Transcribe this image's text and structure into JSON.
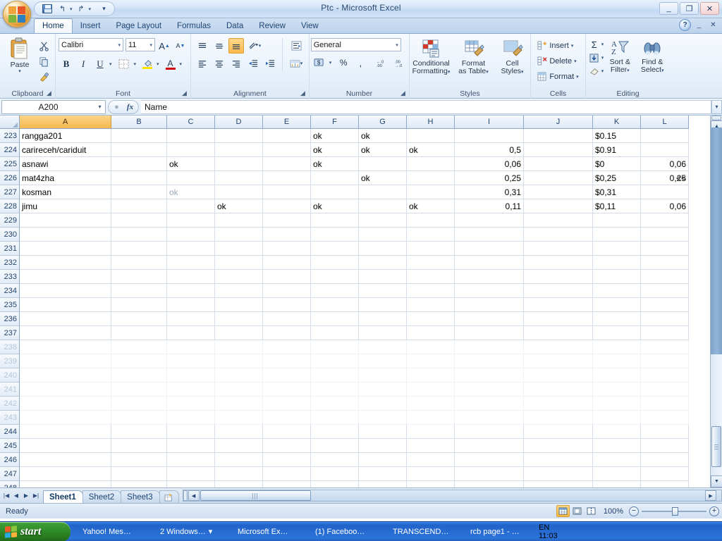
{
  "window": {
    "title": "Ptc - Microsoft Excel",
    "minimize": "_",
    "restore": "❐",
    "close": "✕"
  },
  "quick_access": {
    "save": "save-icon",
    "undo": "↰",
    "undo_arrow": "▾",
    "redo": "↱",
    "redo_arrow": "▾",
    "customize": "▾"
  },
  "ribbon": {
    "tabs": [
      {
        "label": "Home",
        "active": true
      },
      {
        "label": "Insert",
        "active": false
      },
      {
        "label": "Page Layout",
        "active": false
      },
      {
        "label": "Formulas",
        "active": false
      },
      {
        "label": "Data",
        "active": false
      },
      {
        "label": "Review",
        "active": false
      },
      {
        "label": "View",
        "active": false
      }
    ],
    "help": "?",
    "minimize_ribbon": "_",
    "close_window": "✕",
    "groups": {
      "clipboard": {
        "label": "Clipboard",
        "paste": "Paste",
        "paste_arrow": "▾",
        "cut": "✂",
        "copy": "⧉",
        "format_painter": "🖌",
        "dialog": "◢"
      },
      "font": {
        "label": "Font",
        "font_name": "Calibri",
        "font_size": "11",
        "grow_font": "A",
        "shrink_font": "A",
        "bold": "B",
        "italic": "I",
        "underline": "U",
        "borders": "▦",
        "fill_color": "A",
        "font_color": "A",
        "dropdown": "▾",
        "dialog": "◢"
      },
      "alignment": {
        "label": "Alignment",
        "align_top": "≡",
        "align_middle": "≡",
        "align_bottom": "≡",
        "orientation": "⤢",
        "align_left": "≡",
        "align_center": "≡",
        "align_right": "≡",
        "decrease_indent": "⇤",
        "increase_indent": "⇥",
        "wrap_text": "↵",
        "merge_center": "⊞",
        "dropdown": "▾",
        "dialog": "◢"
      },
      "number": {
        "label": "Number",
        "format": "General",
        "accounting": "$",
        "percent": "%",
        "comma": ",",
        "increase_decimal": "+.0",
        "decrease_decimal": "-.0",
        "dropdown": "▾",
        "dialog": "◢"
      },
      "styles": {
        "label": "Styles",
        "conditional_formatting": "Conditional\nFormatting",
        "conditional_formatting_l1": "Conditional",
        "conditional_formatting_l2": "Formatting",
        "format_as_table_l1": "Format",
        "format_as_table_l2": "as Table",
        "cell_styles_l1": "Cell",
        "cell_styles_l2": "Styles",
        "arrow": "▾"
      },
      "cells": {
        "label": "Cells",
        "insert": "Insert",
        "delete": "Delete",
        "format": "Format",
        "arrow": "▾"
      },
      "editing": {
        "label": "Editing",
        "autosum": "Σ",
        "fill": "⬇",
        "clear": "⌫",
        "sort_filter_l1": "Sort &",
        "sort_filter_l2": "Filter",
        "find_select_l1": "Find &",
        "find_select_l2": "Select",
        "arrow": "▾"
      }
    }
  },
  "formula_bar": {
    "name_box": "A200",
    "name_box_arrow": "▾",
    "cancel": "✕",
    "enter": "✓",
    "insert_function": "fx",
    "content": "Name",
    "expand_arrow": "▾"
  },
  "grid": {
    "select_all": "select-all-corner",
    "columns": [
      {
        "letter": "A",
        "width": 130,
        "selected": true
      },
      {
        "letter": "B",
        "width": 79,
        "selected": false
      },
      {
        "letter": "C",
        "width": 68,
        "selected": false
      },
      {
        "letter": "D",
        "width": 68,
        "selected": false
      },
      {
        "letter": "E",
        "width": 68,
        "selected": false
      },
      {
        "letter": "F",
        "width": 68,
        "selected": false
      },
      {
        "letter": "G",
        "width": 68,
        "selected": false
      },
      {
        "letter": "H",
        "width": 68,
        "selected": false
      },
      {
        "letter": "I",
        "width": 98,
        "selected": false
      },
      {
        "letter": "J",
        "width": 98,
        "selected": false
      },
      {
        "letter": "K",
        "width": 68,
        "selected": false
      },
      {
        "letter": "L",
        "width": 68,
        "selected": false
      }
    ],
    "rows": [
      {
        "num": "223",
        "faded": false,
        "cells": {
          "A": "rangga201",
          "F": "ok",
          "G": "ok",
          "K": "$0.15"
        }
      },
      {
        "num": "224",
        "faded": false,
        "cells": {
          "A": "carireceh/cariduit",
          "F": "ok",
          "G": "ok",
          "H": "ok",
          "I": "0,5",
          "K": "$0.91"
        }
      },
      {
        "num": "225",
        "faded": false,
        "cells": {
          "A": "asnawi",
          "C": "ok",
          "F": "ok",
          "I": "0,06",
          "K": "$0",
          "L": "0,06"
        }
      },
      {
        "num": "226",
        "faded": false,
        "cells": {
          "A": "mat4zha",
          "G": "ok",
          "I": "0,25",
          "K": "$0,25",
          "L": "0,25",
          "M": "<<"
        }
      },
      {
        "num": "227",
        "faded": false,
        "cells": {
          "A": "kosman",
          "C": "ok",
          "I": "0,31",
          "K": "$0,31"
        },
        "gray": [
          "C"
        ]
      },
      {
        "num": "228",
        "faded": false,
        "cells": {
          "A": "jimu",
          "D": "ok",
          "F": "ok",
          "H": "ok",
          "I": "0,11",
          "K": "$0,11",
          "L": "0,06"
        }
      },
      {
        "num": "229",
        "faded": false,
        "cells": {}
      },
      {
        "num": "230",
        "faded": false,
        "cells": {}
      },
      {
        "num": "231",
        "faded": false,
        "cells": {}
      },
      {
        "num": "232",
        "faded": false,
        "cells": {}
      },
      {
        "num": "233",
        "faded": false,
        "cells": {}
      },
      {
        "num": "234",
        "faded": false,
        "cells": {}
      },
      {
        "num": "235",
        "faded": false,
        "cells": {}
      },
      {
        "num": "236",
        "faded": false,
        "cells": {}
      },
      {
        "num": "237",
        "faded": false,
        "cells": {}
      },
      {
        "num": "238",
        "faded": true,
        "cells": {}
      },
      {
        "num": "239",
        "faded": true,
        "cells": {}
      },
      {
        "num": "240",
        "faded": true,
        "cells": {}
      },
      {
        "num": "241",
        "faded": true,
        "cells": {}
      },
      {
        "num": "242",
        "faded": true,
        "cells": {}
      },
      {
        "num": "243",
        "faded": true,
        "cells": {}
      },
      {
        "num": "244",
        "faded": false,
        "cells": {}
      },
      {
        "num": "245",
        "faded": false,
        "cells": {}
      },
      {
        "num": "246",
        "faded": false,
        "cells": {}
      },
      {
        "num": "247",
        "faded": false,
        "cells": {}
      },
      {
        "num": "248",
        "faded": false,
        "cells": {}
      }
    ],
    "right_aligned_columns": [
      "I",
      "J",
      "L"
    ],
    "scroll_up": "▲",
    "scroll_down": "▼",
    "scroll_left": "◀",
    "scroll_right": "▶"
  },
  "sheet_tabs": {
    "first": "|◀",
    "prev": "◀",
    "next": "▶",
    "last": "▶|",
    "tabs": [
      {
        "label": "Sheet1",
        "active": true
      },
      {
        "label": "Sheet2",
        "active": false
      },
      {
        "label": "Sheet3",
        "active": false
      }
    ],
    "insert_sheet": "insert-worksheet-icon"
  },
  "status_bar": {
    "state": "Ready",
    "view_normal": "▦",
    "view_page_layout": "▤",
    "view_page_break": "▥",
    "zoom": "100%",
    "zoom_out": "−",
    "zoom_in": "+"
  },
  "taskbar": {
    "start": "start",
    "buttons": [
      {
        "label": "Yahoo! Mes…",
        "icon": "yahoo-messenger-icon",
        "color": "#f5c518",
        "active": false,
        "group": false
      },
      {
        "label": "2 Windows…",
        "icon": "windows-group-icon",
        "color": "#7fb8e8",
        "active": true,
        "group": true,
        "arrow": "▾"
      },
      {
        "label": "Microsoft Ex…",
        "icon": "excel-icon",
        "color": "#1d7044",
        "active": false,
        "group": false
      },
      {
        "label": "(1) Faceboo…",
        "icon": "chrome-icon",
        "color": "#d94a3d",
        "active": false,
        "group": false
      },
      {
        "label": "TRANSCEND…",
        "icon": "drive-icon",
        "color": "#c6ccd4",
        "active": false,
        "group": false
      },
      {
        "label": "rcb page1 - …",
        "icon": "paint-icon",
        "color": "#e8d9a0",
        "active": false,
        "group": false
      }
    ],
    "language": "EN",
    "tray_icons": [
      {
        "name": "show-hidden-icons",
        "color": "#2f8fd0"
      },
      {
        "name": "network-icon",
        "color": "#b8c6d4"
      },
      {
        "name": "usb-device-icon",
        "color": "#9aa8b6"
      },
      {
        "name": "mail-icon",
        "color": "#f0c040"
      },
      {
        "name": "media-player-icon",
        "color": "#3ca050"
      },
      {
        "name": "printer-icon",
        "color": "#cfd8e2"
      },
      {
        "name": "antivirus-icon",
        "color": "#d42c2c"
      },
      {
        "name": "security-center-icon",
        "color": "#c42020"
      }
    ],
    "clock": "11:03"
  }
}
